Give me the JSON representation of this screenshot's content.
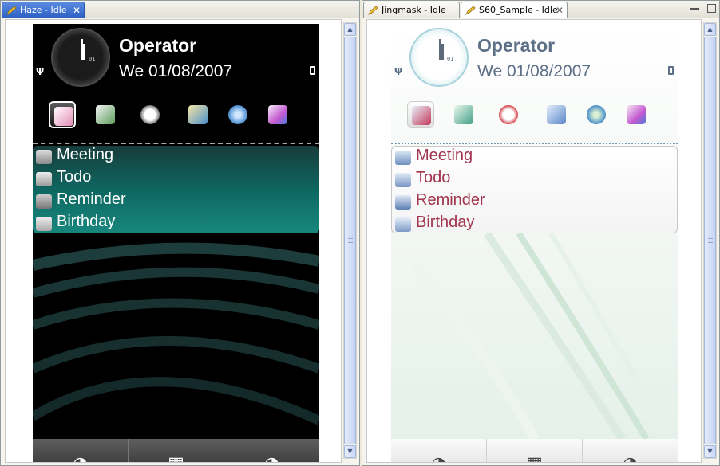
{
  "left_pane": {
    "tab": {
      "label": "Haze - Idle",
      "close": "✕"
    },
    "phone": {
      "operator": "Operator",
      "date": "We 01/08/2007",
      "clock_digits": "01",
      "shortcuts": [
        "messaging-icon",
        "contacts-icon",
        "clock-icon",
        "gallery-icon",
        "web-icon",
        "themes-icon"
      ],
      "calendar_items": [
        {
          "label": "Meeting",
          "icon": "meeting-icon"
        },
        {
          "label": "Todo",
          "icon": "todo-icon"
        },
        {
          "label": "Reminder",
          "icon": "reminder-icon"
        },
        {
          "label": "Birthday",
          "icon": "birthday-icon"
        }
      ],
      "softkeys": [
        "connect-icon",
        "menu-icon",
        "power-icon"
      ]
    }
  },
  "right_pane": {
    "tabs": [
      {
        "label": "Jingmask - Idle"
      },
      {
        "label": "S60_Sample - Idle",
        "close": "✕"
      }
    ],
    "phone": {
      "operator": "Operator",
      "date": "We 01/08/2007",
      "clock_digits": "01",
      "shortcuts": [
        "messaging-icon",
        "contacts-icon",
        "alarm-icon",
        "media-icon",
        "web-icon",
        "themes-icon"
      ],
      "calendar_items": [
        {
          "label": "Meeting",
          "icon": "meeting-icon"
        },
        {
          "label": "Todo",
          "icon": "todo-icon"
        },
        {
          "label": "Reminder",
          "icon": "reminder-icon"
        },
        {
          "label": "Birthday",
          "icon": "birthday-icon"
        }
      ],
      "softkeys": [
        "connect-icon",
        "menu-icon",
        "power-icon"
      ]
    }
  },
  "colors": {
    "haze_calendar": "#0e6a64",
    "jingmask_text": "#5d6f87",
    "jingmask_calendar_text": "#a1344f",
    "tab_active": "#2c5fc4"
  }
}
